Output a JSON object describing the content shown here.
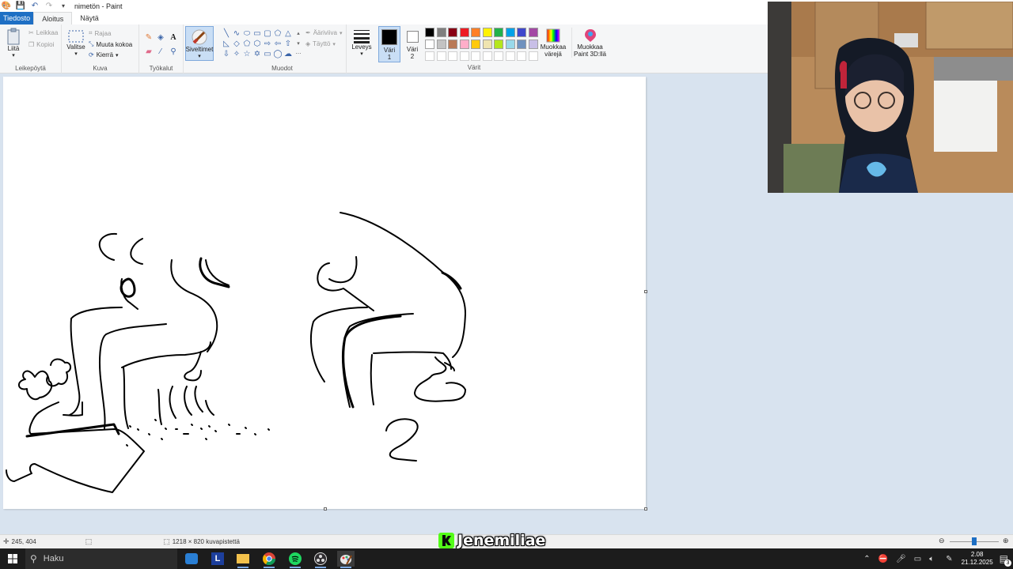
{
  "window": {
    "title": "nimetön - Paint"
  },
  "tabs": [
    {
      "label": "Tiedosto"
    },
    {
      "label": "Aloitus"
    },
    {
      "label": "Näytä"
    }
  ],
  "ribbon": {
    "clipboard": {
      "paste": "Liitä",
      "cut": "Leikkaa",
      "copy": "Kopioi",
      "label": "Leikepöytä"
    },
    "image": {
      "select": "Valitse",
      "crop": "Rajaa",
      "resize": "Muuta kokoa",
      "rotate": "Kierrä",
      "label": "Kuva"
    },
    "tools": {
      "label": "Työkalut"
    },
    "brushes": {
      "label": "Siveltimet"
    },
    "shapes": {
      "outline": "Ääriviiva",
      "fill": "Täyttö",
      "label": "Muodot"
    },
    "size": {
      "label": "Leveys"
    },
    "color1": {
      "label": "Väri 1"
    },
    "color2": {
      "label": "Väri 2"
    },
    "colors": {
      "label": "Värit",
      "palette_row1": [
        "#000000",
        "#7f7f7f",
        "#880015",
        "#ed1c24",
        "#ff7f27",
        "#fff200",
        "#22b14c",
        "#00a2e8",
        "#3f48cc",
        "#a349a4"
      ],
      "palette_row2": [
        "#ffffff",
        "#c3c3c3",
        "#b97a57",
        "#ffaec9",
        "#ffc90e",
        "#efe4b0",
        "#b5e61d",
        "#99d9ea",
        "#7092be",
        "#c8bfe7"
      ]
    },
    "edit_colors": "Muokkaa värejä",
    "paint3d": "Muokkaa Paint 3D:llä"
  },
  "status": {
    "cursor_pos": "245, 404",
    "canvas_size": "1218 × 820 kuvapistettä"
  },
  "watermark": {
    "text": "Jenemiliae"
  },
  "taskbar": {
    "search_placeholder": "Haku",
    "time": "2.08",
    "date": "21.12.2025",
    "notifications": "3"
  }
}
